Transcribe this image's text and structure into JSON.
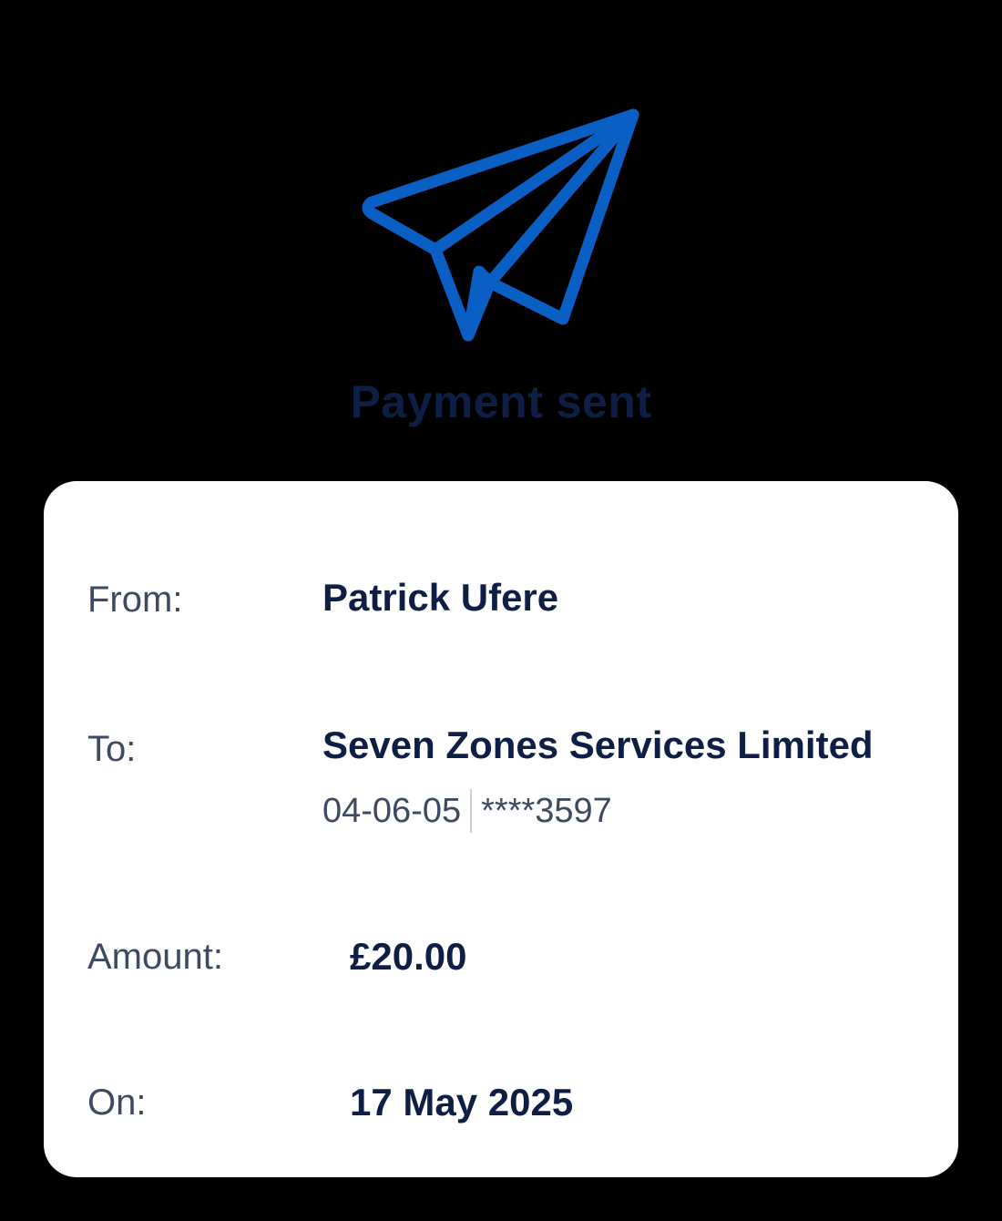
{
  "header": {
    "icon": "paper-plane-icon",
    "title": "Payment sent"
  },
  "details": {
    "from_label": "From:",
    "from_value": "Patrick Ufere",
    "to_label": "To:",
    "to_value": "Seven Zones Services Limited",
    "sort_code": "04-06-05",
    "account_number": "****3597",
    "amount_label": "Amount:",
    "amount_value": "£20.00",
    "date_label": "On:",
    "date_value": "17 May 2025"
  },
  "colors": {
    "background": "#000000",
    "accent_blue": "#0a5fc4",
    "title_navy": "#0e1e45",
    "card": "#ffffff",
    "label_grey": "#3e4a5f"
  }
}
